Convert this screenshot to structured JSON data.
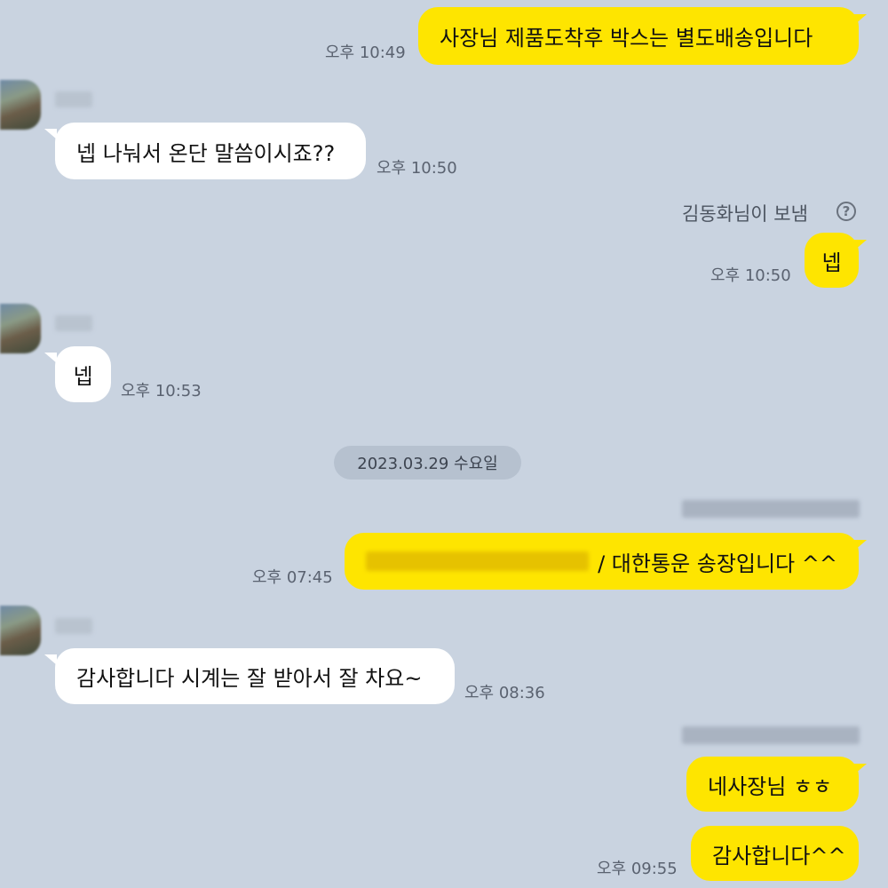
{
  "messages": [
    {
      "text": "사장님 제품도착후 박스는 별도배송입니다",
      "time": "오후 10:49"
    },
    {
      "text": "넵 나눠서 온단 말씀이시죠??",
      "time": "오후 10:50"
    },
    {
      "sent_by": "김동화님이 보냄",
      "help_symbol": "?"
    },
    {
      "text": "넵",
      "time": "오후 10:50"
    },
    {
      "text": "넵",
      "time": "오후 10:53"
    },
    {
      "date_divider": "2023.03.29 수요일"
    },
    {
      "text_suffix": "/ 대한통운 송장입니다 ^^",
      "time": "오후 07:45"
    },
    {
      "text": "감사합니다 시계는 잘 받아서 잘 차요~",
      "time": "오후 08:36"
    },
    {
      "text": "네사장님 ㅎㅎ"
    },
    {
      "text": "감사합니다^^",
      "time": "오후 09:55"
    }
  ],
  "colors": {
    "background": "#c9d3e0",
    "my_bubble": "#fee500",
    "other_bubble": "#ffffff",
    "date_pill": "#b6c1cf"
  }
}
